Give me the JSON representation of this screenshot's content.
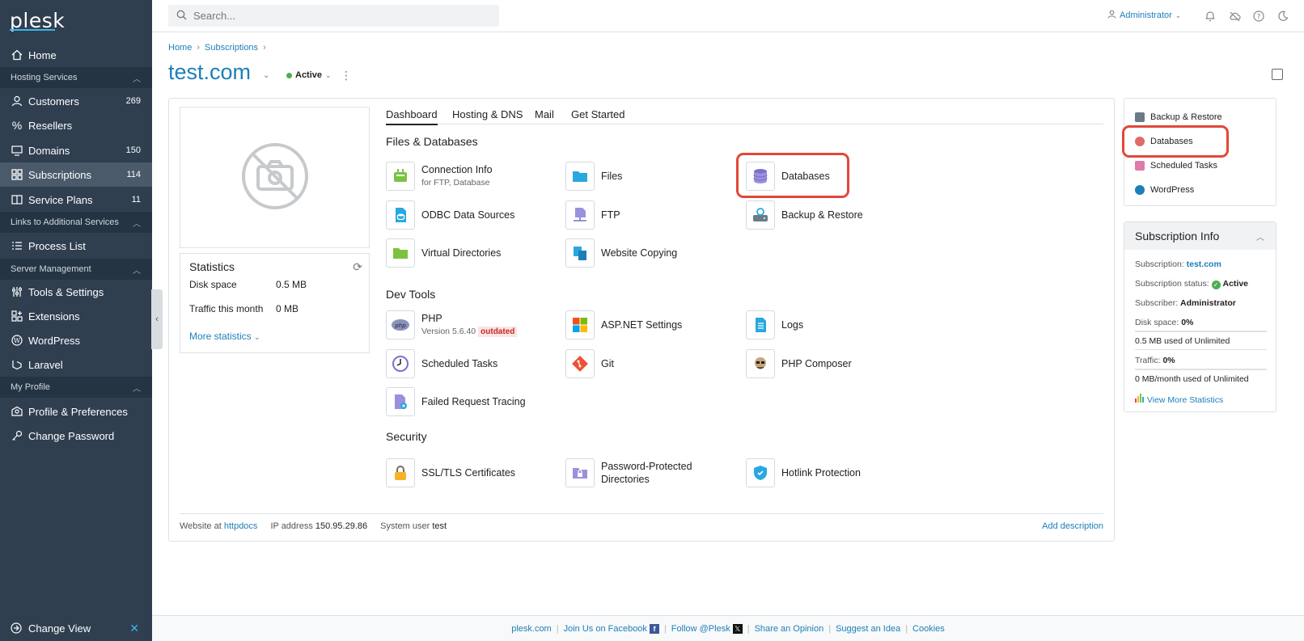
{
  "app": {
    "logo": "plesk"
  },
  "sidebar": {
    "home": "Home",
    "sections": [
      {
        "label": "Hosting Services"
      },
      {
        "label": "Links to Additional Services"
      },
      {
        "label": "Server Management"
      },
      {
        "label": "My Profile"
      }
    ],
    "items": [
      {
        "label": "Customers",
        "count": "269"
      },
      {
        "label": "Resellers",
        "count": ""
      },
      {
        "label": "Domains",
        "count": "150"
      },
      {
        "label": "Subscriptions",
        "count": "114"
      },
      {
        "label": "Service Plans",
        "count": "11"
      },
      {
        "label": "Process List",
        "count": ""
      },
      {
        "label": "Tools & Settings",
        "count": ""
      },
      {
        "label": "Extensions",
        "count": ""
      },
      {
        "label": "WordPress",
        "count": ""
      },
      {
        "label": "Laravel",
        "count": ""
      },
      {
        "label": "Profile & Preferences",
        "count": ""
      },
      {
        "label": "Change Password",
        "count": ""
      }
    ],
    "change_view": "Change View"
  },
  "topbar": {
    "search_placeholder": "Search...",
    "user": "Administrator"
  },
  "breadcrumb": [
    "Home",
    "Subscriptions"
  ],
  "page": {
    "title": "test.com",
    "status": "Active"
  },
  "statistics": {
    "title": "Statistics",
    "disk_label": "Disk space",
    "disk_value": "0.5 MB",
    "traffic_label": "Traffic this month",
    "traffic_value": "0 MB",
    "more": "More statistics"
  },
  "tabs": [
    "Dashboard",
    "Hosting & DNS",
    "Mail",
    "Get Started"
  ],
  "sections": {
    "files": "Files & Databases",
    "dev": "Dev Tools",
    "security": "Security"
  },
  "tools": {
    "connection": {
      "label": "Connection Info",
      "sub": "for FTP, Database"
    },
    "files": "Files",
    "databases": "Databases",
    "odbc": "ODBC Data Sources",
    "ftp": "FTP",
    "backup": "Backup & Restore",
    "vdirs": "Virtual Directories",
    "copying": "Website Copying",
    "php": {
      "label": "PHP",
      "sub": "Version 5.6.40",
      "badge": "outdated"
    },
    "aspnet": "ASP.NET Settings",
    "logs": "Logs",
    "scheduled": "Scheduled Tasks",
    "git": "Git",
    "composer": "PHP Composer",
    "tracing": "Failed Request Tracing",
    "ssl": "SSL/TLS Certificates",
    "pwdirs": "Password-Protected Directories",
    "hotlink": "Hotlink Protection"
  },
  "card_footer": {
    "website_label": "Website at",
    "website_value": "httpdocs",
    "ip_label": "IP address",
    "ip_value": "150.95.29.86",
    "user_label": "System user",
    "user_value": "test",
    "add_description": "Add description"
  },
  "quick_links": [
    "Backup & Restore",
    "Databases",
    "Scheduled Tasks",
    "WordPress"
  ],
  "subscription_info": {
    "title": "Subscription Info",
    "subscription_label": "Subscription:",
    "subscription_value": "test.com",
    "status_label": "Subscription status:",
    "status_value": "Active",
    "subscriber_label": "Subscriber:",
    "subscriber_value": "Administrator",
    "disk_label": "Disk space:",
    "disk_value": "0%",
    "disk_used": "0.5 MB used of Unlimited",
    "traffic_label": "Traffic:",
    "traffic_value": "0%",
    "traffic_used": "0 MB/month used of Unlimited",
    "view_more": "View More Statistics"
  },
  "footer": [
    "plesk.com",
    "Join Us on Facebook",
    "Follow @Plesk",
    "Share an Opinion",
    "Suggest an Idea",
    "Cookies"
  ],
  "colors": {
    "sidebar": "#2f3f50",
    "link": "#1d7fb8",
    "highlight": "#e0483a",
    "active": "#4caf50"
  }
}
